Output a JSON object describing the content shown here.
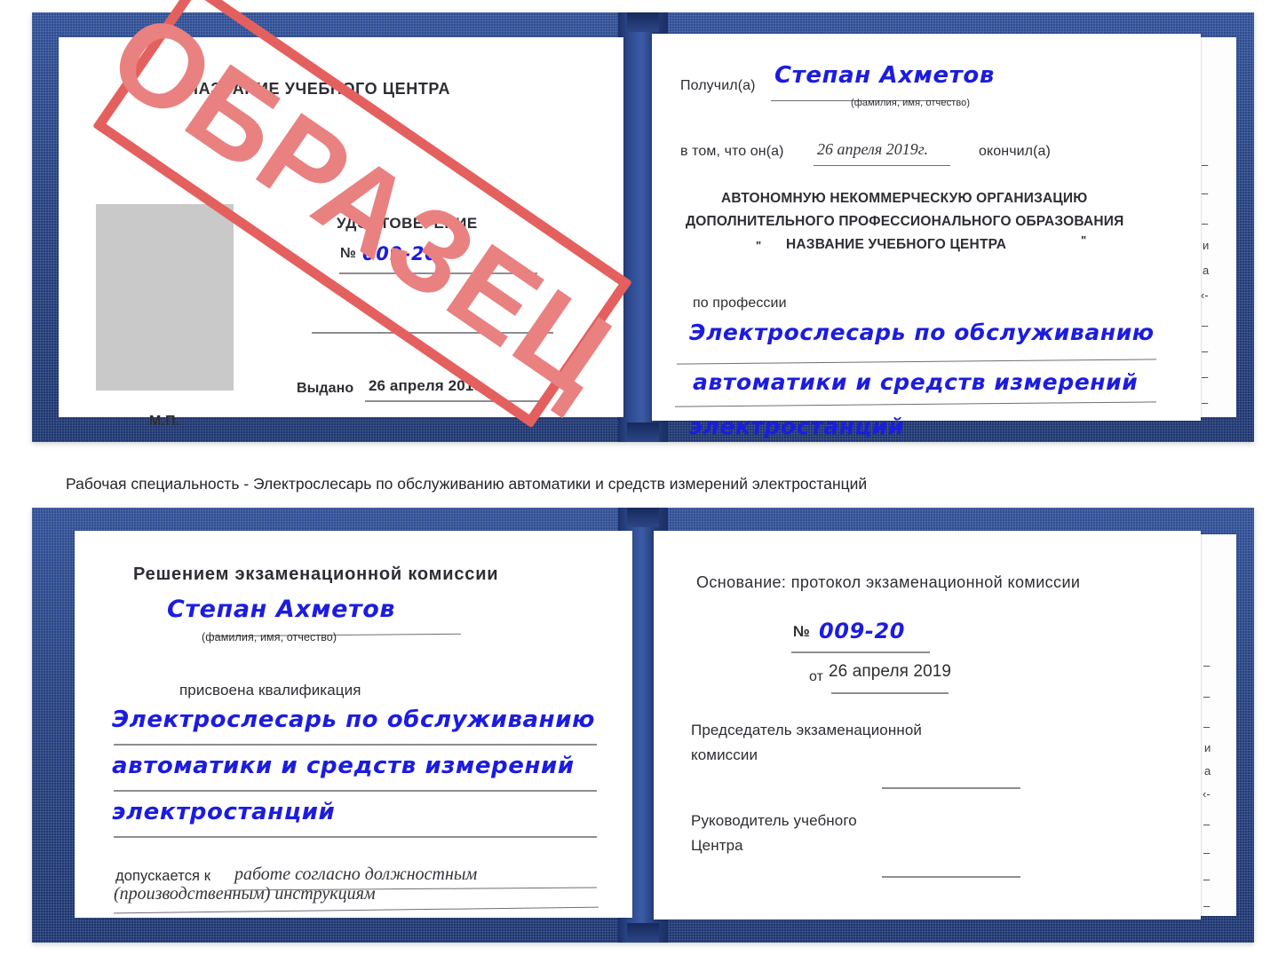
{
  "watermark": {
    "label": "ОБРАЗЕЦ",
    "color": "#e4605e",
    "angle_deg": 34.5
  },
  "caption": {
    "text": "Рабочая специальность - Электрослесарь по обслуживанию автоматики и средств измерений электростанций"
  },
  "colors": {
    "cover_blue": "#24407f",
    "handwriting_blue": "#1c1ce0",
    "print_gray": "#2d2d33",
    "rule_gray": "#8d8d92",
    "photo_placeholder": "#c9c9c9"
  },
  "certificate_front": {
    "left_page": {
      "center_title": "НАЗВАНИЕ УЧЕБНОГО ЦЕНТРА",
      "doc_type": "УДОСТОВЕРЕНИЕ",
      "number_label": "№",
      "number_value": "009-20",
      "issued_label": "Выдано",
      "issued_value": "26 апреля 2019",
      "stamp_label": "М.П.",
      "photo_placeholder": "photo-box"
    },
    "right_page": {
      "received_label": "Получил(а)",
      "received_value": "Степан Ахметов",
      "received_hint": "(фамилия, имя, отчество)",
      "in_that_label": "в том, что он(а)",
      "completion_date": "26 апреля 2019г.",
      "finished_label": "окончил(а)",
      "org_line_1": "АВТОНОМНУЮ НЕКОММЕРЧЕСКУЮ ОРГАНИЗАЦИЮ",
      "org_line_2": "ДОПОЛНИТЕЛЬНОГО ПРОФЕССИОНАЛЬНОГО ОБРАЗОВАНИЯ",
      "org_quote_open": "\"",
      "org_line_3": "НАЗВАНИЕ УЧЕБНОГО ЦЕНТРА",
      "org_quote_close": "\"",
      "profession_label": "по профессии",
      "profession_line_1": "Электрослесарь по обслуживанию",
      "profession_line_2": "автоматики и средств измерений",
      "profession_line_3": "электростанций",
      "margin_fragments": [
        "–",
        "–",
        "–",
        "и",
        "а",
        "‹-",
        "–",
        "–",
        "–",
        "–"
      ]
    }
  },
  "certificate_back": {
    "left_page": {
      "heading": "Решением экзаменационной комиссии",
      "name_value": "Степан Ахметов",
      "name_hint": "(фамилия, имя, отчество)",
      "qualification_label": "присвоена квалификация",
      "qualification_line_1": "Электрослесарь по обслуживанию",
      "qualification_line_2": "автоматики и средств измерений",
      "qualification_line_3": "электростанций",
      "allowed_label": "допускается к",
      "allowed_value_1": "работе согласно должностным",
      "allowed_value_2": "(производственным) инструкциям"
    },
    "right_page": {
      "basis_label": "Основание: протокол экзаменационной комиссии",
      "number_label": "№",
      "number_value": "009-20",
      "date_label": "от",
      "date_value": "26 апреля 2019",
      "chairman_line_1": "Председатель экзаменационной",
      "chairman_line_2": "комиссии",
      "director_line_1": "Руководитель учебного",
      "director_line_2": "Центра",
      "margin_fragments": [
        "–",
        "–",
        "–",
        "и",
        "а",
        "‹-",
        "–",
        "–",
        "–",
        "–"
      ]
    }
  }
}
